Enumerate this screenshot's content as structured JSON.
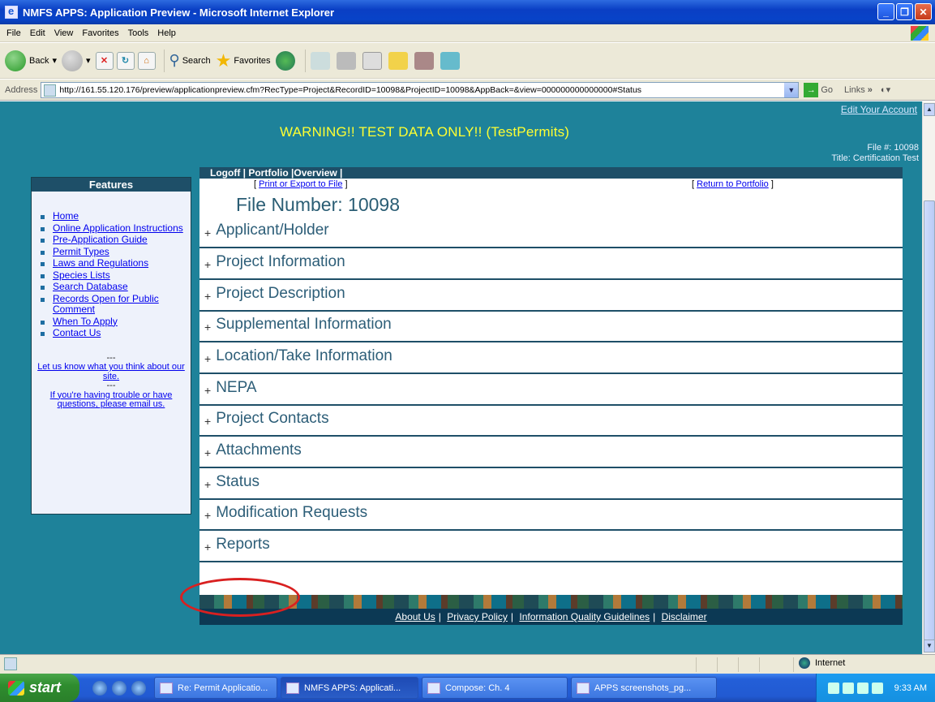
{
  "window": {
    "title": "NMFS APPS: Application Preview - Microsoft Internet Explorer"
  },
  "menu": [
    "File",
    "Edit",
    "View",
    "Favorites",
    "Tools",
    "Help"
  ],
  "toolbar": {
    "back": "Back",
    "search": "Search",
    "favorites": "Favorites"
  },
  "address": {
    "label": "Address",
    "url": "http://161.55.120.176/preview/applicationpreview.cfm?RecType=Project&RecordID=10098&ProjectID=10098&AppBack=&view=000000000000000#Status",
    "go": "Go",
    "links": "Links"
  },
  "page": {
    "edit_account": "Edit Your Account",
    "warning": "WARNING!! TEST DATA ONLY!! (TestPermits)",
    "file_no_label": "File #: 10098",
    "title_label": "Title: Certification Test",
    "nav": "Logoff | Portfolio |Overview |",
    "print_link": "Print or Export to File",
    "return_link": "Return to Portfolio",
    "file_number": "File Number: 10098",
    "sections": [
      "Applicant/Holder",
      "Project Information",
      "Project Description",
      "Supplemental Information",
      "Location/Take Information",
      "NEPA",
      "Project Contacts",
      "Attachments",
      "Status",
      "Modification Requests",
      "Reports"
    ],
    "footer_links": [
      "About Us",
      "Privacy Policy",
      "Information Quality Guidelines",
      "Disclaimer"
    ]
  },
  "features": {
    "heading": "Features",
    "items": [
      "Home",
      "Online Application Instructions",
      "Pre-Application Guide",
      "Permit Types",
      "Laws and Regulations",
      "Species Lists",
      "Search Database",
      "Records Open for Public Comment",
      "When To Apply",
      "Contact Us"
    ],
    "dash": "---",
    "feedback": "Let us know what you think about our site.",
    "trouble": "If you're having trouble or have questions, please email us."
  },
  "statusbar": {
    "zone": "Internet"
  },
  "taskbar": {
    "start": "start",
    "tasks": [
      "Re: Permit Applicatio...",
      "NMFS APPS: Applicati...",
      "Compose: Ch. 4",
      "APPS screenshots_pg..."
    ],
    "clock": "9:33 AM"
  }
}
